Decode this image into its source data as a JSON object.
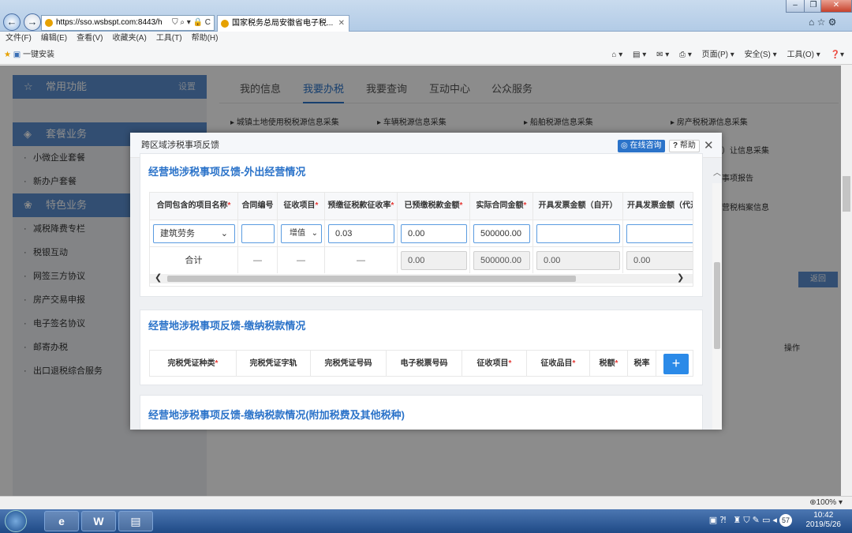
{
  "browser": {
    "url": "https://sso.wsbspt.com:8443/h",
    "tab_title": "国家税务总局安徽省电子税...",
    "menu": [
      "文件(F)",
      "编辑(E)",
      "查看(V)",
      "收藏夹(A)",
      "工具(T)",
      "帮助(H)"
    ],
    "fav_label": "一键安装",
    "tools": [
      "页面(P) ▾",
      "安全(S) ▾",
      "工具(O) ▾"
    ],
    "zoom": "100%"
  },
  "sidebar": {
    "common": "常用功能",
    "settings": "设置",
    "package": "套餐业务",
    "package_items": [
      "小微企业套餐",
      "新办户套餐"
    ],
    "special": "特色业务",
    "special_items": [
      "减税降费专栏",
      "税银互动",
      "网签三方协议",
      "房产交易申报",
      "电子签名协议",
      "邮寄办税",
      "出口退税综合服务"
    ]
  },
  "mainnav": {
    "tabs": [
      "我的信息",
      "我要办税",
      "我要查询",
      "互动中心",
      "公众服务"
    ]
  },
  "background": {
    "items": [
      "城镇土地使用税税源信息采集",
      "车辆税源信息采集",
      "船舶税源信息采集",
      "房产税税源信息采集"
    ],
    "right_items": [
      "）让信息采集",
      "事项报告",
      "营税档案信息"
    ],
    "back": "返回",
    "operate": "操作"
  },
  "modal": {
    "title": "跨区域涉税事项反馈",
    "consult": "在线咨询",
    "help": "帮助",
    "section1": {
      "title": "经营地涉税事项反馈-外出经营情况",
      "headers": [
        "合同包含的项目名称",
        "合同编号",
        "征收项目",
        "预缴征税款征收率",
        "已预缴税款金额",
        "实际合同金额",
        "开具发票金额（自开）",
        "开具发票金额（代开）"
      ],
      "required": [
        true,
        false,
        true,
        true,
        true,
        true,
        false,
        false
      ],
      "row": {
        "project": "建筑劳务",
        "contract_no": "",
        "levy": "增值",
        "rate": "0.03",
        "prepaid": "0.00",
        "actual": "500000.00",
        "self_invoice": "",
        "agent_invoice": ""
      },
      "total": {
        "label": "合计",
        "dash": "—",
        "prepaid": "0.00",
        "actual": "500000.00",
        "self_invoice": "0.00",
        "agent_invoice": "0.00"
      }
    },
    "section2": {
      "title": "经营地涉税事项反馈-缴纳税款情况",
      "headers": [
        "完税凭证种类",
        "完税凭证字轨",
        "完税凭证号码",
        "电子税票号码",
        "征收项目",
        "征收品目",
        "税额",
        "税率"
      ],
      "required": [
        true,
        false,
        false,
        false,
        true,
        true,
        true,
        false
      ],
      "add": "+"
    },
    "section3": {
      "title": "经营地涉税事项反馈-缴纳税款情况(附加税费及其他税种)"
    }
  },
  "taskbar": {
    "time": "10:42",
    "date": "2019/5/26",
    "badge": "57"
  }
}
